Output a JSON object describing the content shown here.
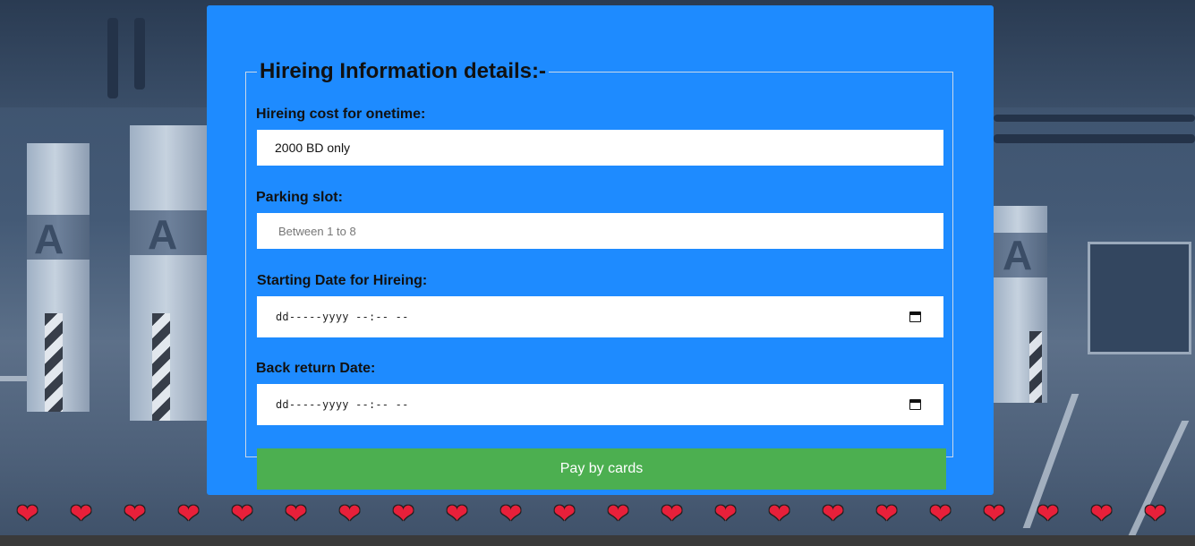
{
  "form": {
    "legend": "Hireing Information details:-",
    "cost_label": "Hireing cost for onetime:",
    "cost_value": "2000 BD only",
    "slot_label": "Parking slot:",
    "slot_placeholder": "Between 1 to 8",
    "start_label": "Starting Date for Hireing:",
    "start_value": "dd-----yyyy --:-- --",
    "return_label": "Back return Date:",
    "return_value": "dd-----yyyy --:-- --",
    "pay_button": "Pay by cards"
  },
  "icons": {
    "calendar": "calendar-icon",
    "heart": "heart-icon"
  },
  "colors": {
    "card_bg": "#1e8bff",
    "button_bg": "#4caf50",
    "heart": "#e8203a"
  },
  "hearts_count": 22
}
